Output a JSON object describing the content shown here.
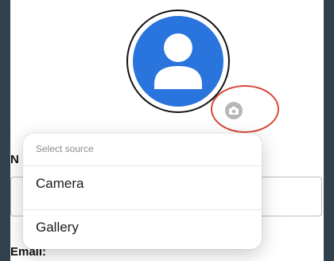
{
  "form": {
    "name_label_visible": "N",
    "email_label": "Email:"
  },
  "source_sheet": {
    "title": "Select source",
    "options": [
      "Camera",
      "Gallery"
    ]
  },
  "icons": {
    "avatar": "person-icon",
    "badge": "camera-icon"
  },
  "colors": {
    "avatar_blue": "#2a74de",
    "highlight_red": "#d9483a",
    "badge_gray": "#b6b6b6"
  }
}
